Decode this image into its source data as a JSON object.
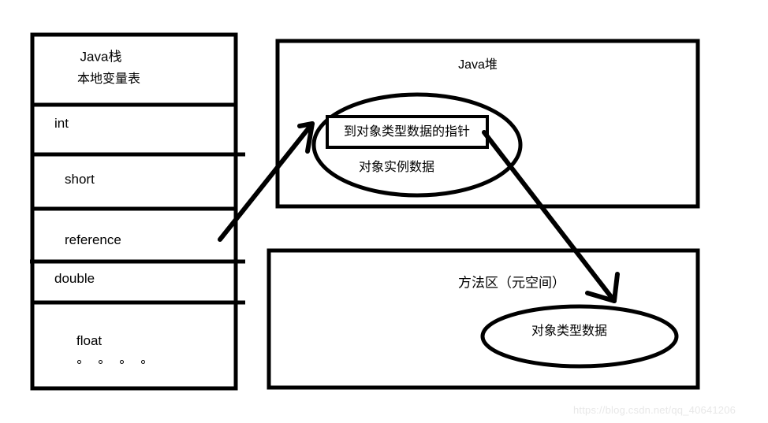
{
  "diagram": {
    "title_semantic": "jvm-memory-layout-diagram",
    "stack": {
      "header_title": "Java栈",
      "header_subtitle": "本地变量表",
      "slots": [
        {
          "label": "int"
        },
        {
          "label": "short"
        },
        {
          "label": "reference"
        },
        {
          "label": "double"
        },
        {
          "label": "float"
        }
      ],
      "ellipsis_dots": 4
    },
    "heap": {
      "title": "Java堆",
      "pointer_box_label": "到对象类型数据的指针",
      "instance_data_label": "对象实例数据"
    },
    "method_area": {
      "title": "方法区（元空间）",
      "object_type_label": "对象类型数据"
    },
    "arrows": [
      {
        "name": "reference-to-heap-arrow"
      },
      {
        "name": "heap-pointer-to-method-area-arrow"
      }
    ],
    "colors": {
      "stroke": "#000000",
      "background": "#ffffff",
      "watermark": "#e8e8e8"
    }
  },
  "watermark": {
    "text": "https://blog.csdn.net/qq_40641206"
  }
}
